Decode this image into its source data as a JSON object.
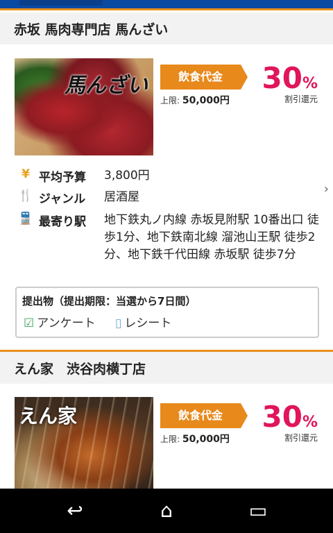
{
  "header": {},
  "restaurants": [
    {
      "name": "赤坂 馬肉専門店 馬んざい",
      "photo_logo": "馬んざい",
      "badge": "飲食代金",
      "limit_label": "上限:",
      "limit_value": "50,000円",
      "discount_percent": "30",
      "discount_sign": "%",
      "discount_label": "割引還元",
      "budget_label": "平均予算",
      "budget_value": "3,800円",
      "genre_label": "ジャンル",
      "genre_value": "居酒屋",
      "station_label": "最寄り駅",
      "station_value": "地下鉄丸ノ内線 赤坂見附駅 10番出口 徒歩1分、地下鉄南北線 溜池山王駅 徒歩2分、地下鉄千代田線 赤坂駅 徒歩7分",
      "submission_title": "提出物（提出期限：当選から7日間）",
      "submission_items": [
        "アンケート",
        "レシート"
      ]
    },
    {
      "name": "えん家　渋谷肉横丁店",
      "photo_logo": "えん家",
      "badge": "飲食代金",
      "limit_label": "上限:",
      "limit_value": "50,000円",
      "discount_percent": "30",
      "discount_sign": "%",
      "discount_label": "割引還元"
    }
  ],
  "icons": {
    "yen": "yen-icon",
    "genre": "fork-knife-icon",
    "station": "train-icon",
    "check": "checkbox-icon",
    "receipt": "receipt-icon",
    "chevron": "chevron-right-icon",
    "back": "back-icon",
    "home": "home-icon",
    "recent": "recent-apps-icon"
  },
  "colors": {
    "accent": "#e8891c",
    "discount": "#e0155b",
    "topbar": "#0b4aa2"
  }
}
